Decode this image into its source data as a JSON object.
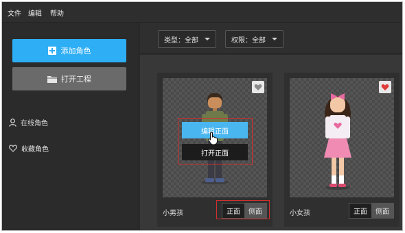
{
  "menu": {
    "file": "文件",
    "edit": "编辑",
    "help": "帮助"
  },
  "sidebar": {
    "add_role": "添加角色",
    "open_project": "打开工程",
    "online_roles": "在线角色",
    "favorite_roles": "收藏角色"
  },
  "filters": {
    "type_label": "类型：全部",
    "permission_label": "权限：全部"
  },
  "cards": [
    {
      "name": "小男孩",
      "favorited": false,
      "front": "正面",
      "side": "侧面",
      "hover_edit": "编辑正面",
      "hover_open": "打开正面"
    },
    {
      "name": "小女孩",
      "favorited": true,
      "front": "正面",
      "side": "侧面"
    }
  ],
  "colors": {
    "accent": "#2eaef5",
    "favorite_red": "#e03b3b",
    "annotation_red": "#d42f2f"
  }
}
